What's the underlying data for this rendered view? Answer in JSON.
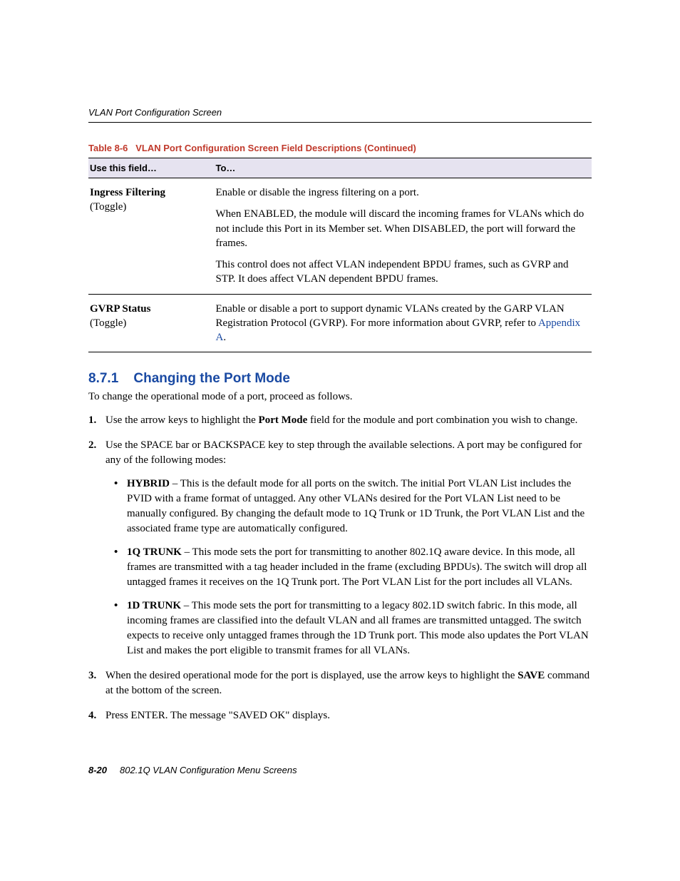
{
  "header": {
    "running_title": "VLAN Port Configuration Screen"
  },
  "table": {
    "caption_label": "Table 8-6",
    "caption_text": "VLAN Port Configuration Screen Field Descriptions (Continued)",
    "col1": "Use this field…",
    "col2": "To…",
    "rows": [
      {
        "field_name": "Ingress Filtering",
        "field_sub": "(Toggle)",
        "desc_p1": "Enable or disable the ingress filtering on a port.",
        "desc_p2": "When ENABLED, the module will discard the incoming frames for VLANs which do not include this Port in its Member set. When DISABLED, the port will forward the frames.",
        "desc_p3": "This control does not affect VLAN independent BPDU frames, such as GVRP and STP. It does affect VLAN dependent BPDU frames."
      },
      {
        "field_name": "GVRP Status",
        "field_sub": "(Toggle)",
        "desc_p1a": "Enable or disable a port to support dynamic VLANs created by the GARP VLAN Registration Protocol (GVRP). For more information about GVRP, refer to ",
        "desc_link": "Appendix A",
        "desc_p1b": "."
      }
    ]
  },
  "section": {
    "number": "8.7.1",
    "title": "Changing the Port Mode",
    "intro": "To change the operational mode of a port, proceed as follows.",
    "steps": {
      "s1a": "Use the arrow keys to highlight the ",
      "s1_bold": "Port Mode",
      "s1b": " field for the module and port combination you wish to change.",
      "s2": "Use the SPACE bar or BACKSPACE key to step through the available selections. A port may be configured for any of the following modes:",
      "modes": [
        {
          "name": "HYBRID",
          "text": " – This is the default mode for all ports on the switch. The initial Port VLAN List includes the PVID with a frame format of untagged. Any other VLANs desired for the Port VLAN List need to be manually configured. By changing the default mode to 1Q Trunk or 1D Trunk, the Port VLAN List and the associated frame type are automatically configured."
        },
        {
          "name": "1Q TRUNK",
          "text": " – This mode sets the port for transmitting to another 802.1Q aware device. In this mode, all frames are transmitted with a tag header included in the frame (excluding BPDUs). The switch will drop all untagged frames it receives on the 1Q Trunk port. The Port VLAN List for the port includes all VLANs."
        },
        {
          "name": "1D TRUNK",
          "text": " – This mode sets the port for transmitting to a legacy 802.1D switch fabric. In this mode, all incoming frames are classified into the default VLAN and all frames are transmitted untagged. The switch expects to receive only untagged frames through the 1D Trunk port. This mode also updates the Port VLAN List and makes the port eligible to transmit frames for all VLANs."
        }
      ],
      "s3a": "When the desired operational mode for the port is displayed, use the arrow keys to highlight the ",
      "s3_bold": "SAVE",
      "s3b": " command at the bottom of the screen.",
      "s4": "Press ENTER. The message \"SAVED OK\" displays."
    }
  },
  "footer": {
    "page_number": "8-20",
    "chapter_title": "802.1Q VLAN Configuration Menu Screens"
  }
}
